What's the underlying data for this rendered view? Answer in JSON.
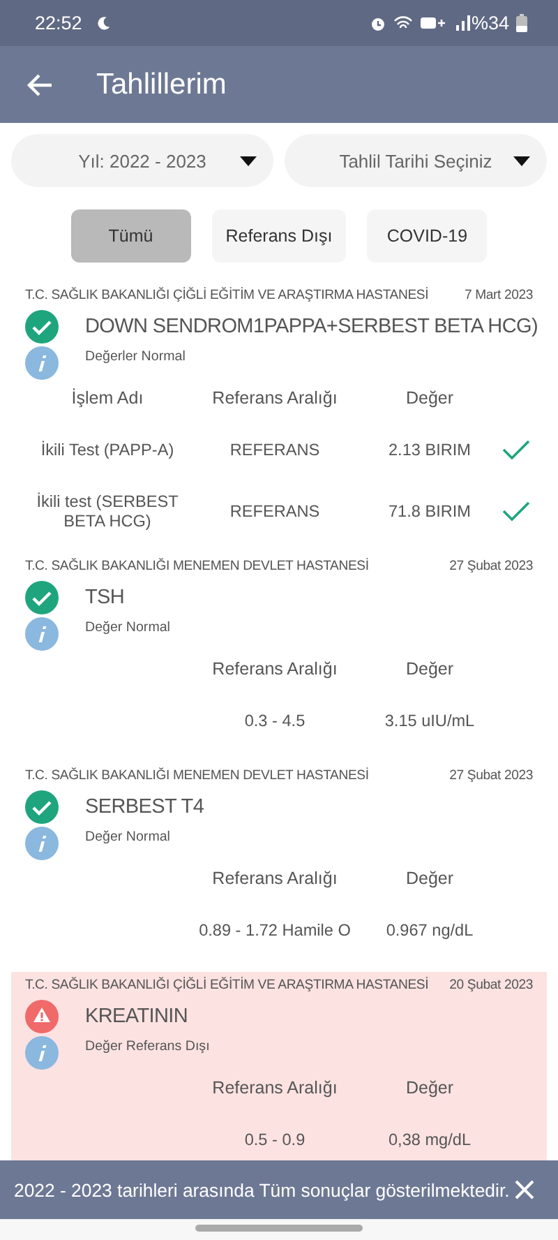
{
  "status_bar": {
    "time": "22:52",
    "battery": "%34"
  },
  "app_bar": {
    "title": "Tahlillerim"
  },
  "dropdowns": [
    {
      "value": "Yıl: 2022 - 2023"
    },
    {
      "value": "Tahlil Tarihi Seçiniz"
    }
  ],
  "filters": [
    {
      "label": "Tümü",
      "selected": true
    },
    {
      "label": "Referans Dışı",
      "selected": false
    },
    {
      "label": "COVID-19",
      "selected": false
    }
  ],
  "results": [
    {
      "hospital": "T.C. SAĞLIK BAKANLIĞI ÇİĞLİ EĞİTİM VE ARAŞTIRMA HASTANESİ",
      "date": "7 Mart 2023",
      "out_of_range": false,
      "test": "DOWN SENDROM1PAPPA+SERBEST BETA HCG)",
      "note": "Değerler Normal",
      "headers": {
        "name": "İşlem Adı",
        "reference": "Referans Aralığı",
        "value": "Değer"
      },
      "rows": [
        {
          "name": "İkili Test (PAPP-A)",
          "reference": "REFERANS",
          "value": "2.13 BIRIM",
          "checked": true
        },
        {
          "name": "İkili test (SERBEST BETA HCG)",
          "reference": "REFERANS",
          "value": "71.8 BIRIM",
          "checked": true
        }
      ]
    },
    {
      "hospital": "T.C. SAĞLIK BAKANLIĞI MENEMEN DEVLET HASTANESİ",
      "date": "27 Şubat 2023",
      "out_of_range": false,
      "test": "TSH",
      "note": "Değer Normal",
      "headers": {
        "reference": "Referans Aralığı",
        "value": "Değer"
      },
      "rows": [
        {
          "reference": "0.3 - 4.5",
          "value": "3.15 uIU/mL"
        }
      ]
    },
    {
      "hospital": "T.C. SAĞLIK BAKANLIĞI MENEMEN DEVLET HASTANESİ",
      "date": "27 Şubat 2023",
      "out_of_range": false,
      "test": "SERBEST T4",
      "note": "Değer Normal",
      "headers": {
        "reference": "Referans Aralığı",
        "value": "Değer"
      },
      "rows": [
        {
          "reference": "0.89 - 1.72  Hamile O",
          "value": "0.967 ng/dL"
        }
      ]
    },
    {
      "hospital": "T.C. SAĞLIK BAKANLIĞI ÇİĞLİ EĞİTİM VE ARAŞTIRMA HASTANESİ",
      "date": "20 Şubat 2023",
      "out_of_range": true,
      "test": "KREATININ",
      "note": "Değer Referans Dışı",
      "headers": {
        "reference": "Referans Aralığı",
        "value": "Değer"
      },
      "rows": [
        {
          "reference": "0.5 - 0.9",
          "value": "0,38 mg/dL"
        }
      ]
    }
  ],
  "snackbar": {
    "message": "2022 - 2023 tarihleri arasında Tüm sonuçlar gösterilmektedir."
  }
}
